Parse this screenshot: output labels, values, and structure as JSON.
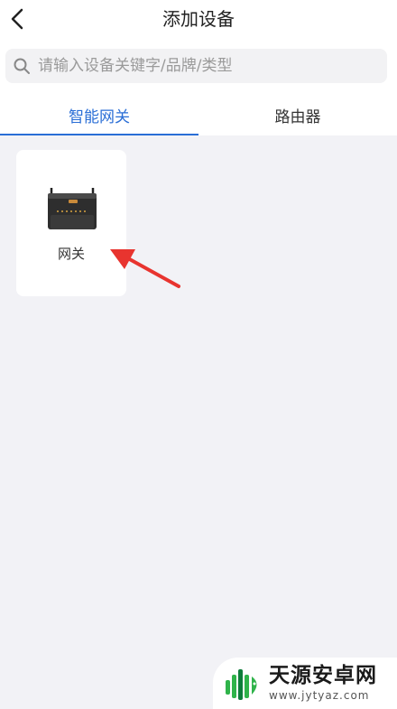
{
  "header": {
    "title": "添加设备",
    "back_icon": "chevron-left-icon"
  },
  "search": {
    "placeholder": "请输入设备关键字/品牌/类型",
    "value": "",
    "icon": "search-icon"
  },
  "tabs": [
    {
      "label": "智能网关",
      "active": true
    },
    {
      "label": "路由器",
      "active": false
    }
  ],
  "devices": [
    {
      "label": "网关",
      "icon": "gateway-device-image"
    }
  ],
  "annotation": {
    "icon": "red-arrow-icon",
    "color": "#e8342f"
  },
  "watermark": {
    "brand": "天源安卓网",
    "url": "www.jytyaz.com",
    "logo_colors": [
      "#2fb34a",
      "#0e7d3a"
    ]
  },
  "colors": {
    "accent": "#2a6ed6",
    "background": "#f2f2f6"
  }
}
